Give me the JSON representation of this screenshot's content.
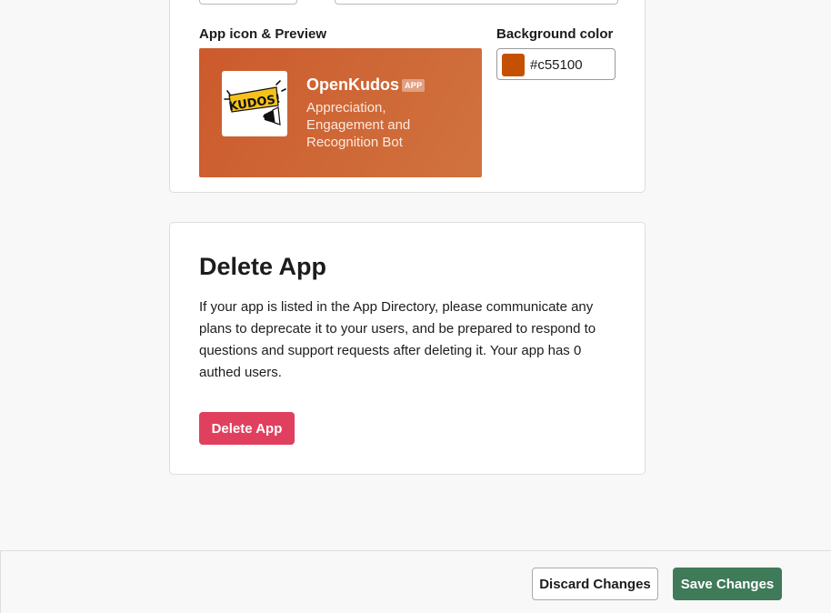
{
  "display_info": {
    "section_label_preview": "App icon & Preview",
    "section_label_background": "Background color",
    "app_name": "OpenKudos",
    "app_badge": "APP",
    "app_description": "Appreciation, Engagement and Recognition Bot",
    "icon_text": "KUDOS!",
    "background_color_value": "#c55100",
    "colors": {
      "background_swatch": "#c55100",
      "preview_gradient_start": "#cc5a2c",
      "preview_gradient_end": "#d0733f"
    }
  },
  "delete_section": {
    "title": "Delete App",
    "description": "If your app is listed in the App Directory, please communicate any plans to deprecate it to your users, and be prepared to respond to questions and support requests after deleting it. Your app has 0 authed users.",
    "button_label": "Delete App",
    "button_color": "#e0405e"
  },
  "footer": {
    "discard_label": "Discard Changes",
    "save_label": "Save Changes",
    "save_color": "#3f7a59"
  },
  "icons": {
    "app_icon": "kudos-megaphone-icon",
    "color_swatch": "color-swatch"
  }
}
